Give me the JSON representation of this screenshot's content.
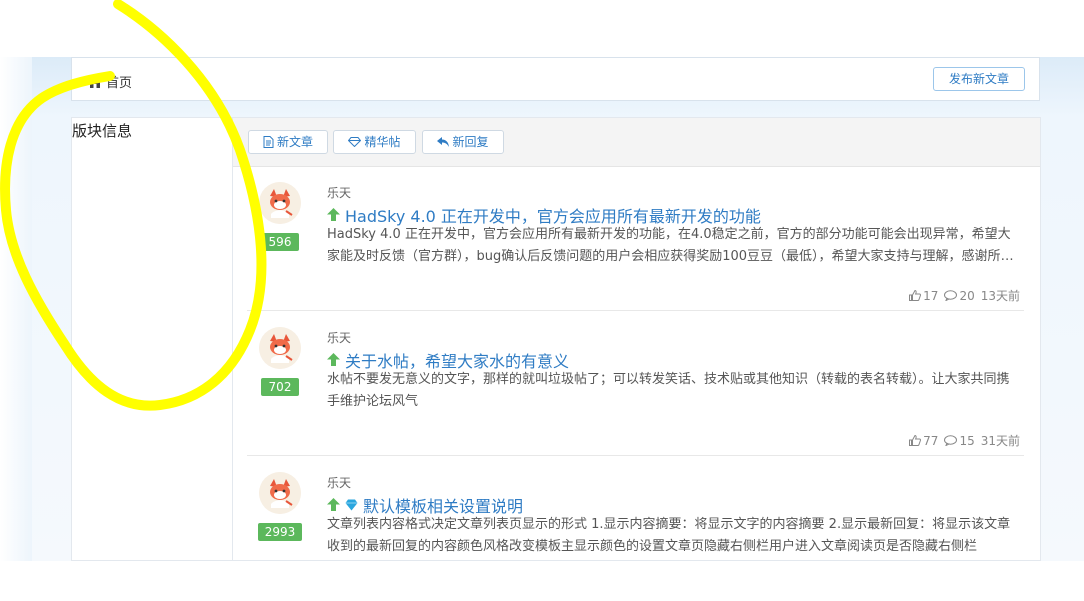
{
  "breadcrumb": {
    "home_label": "首页"
  },
  "header": {
    "publish_label": "发布新文章"
  },
  "sidebar": {
    "title": "版块信息"
  },
  "tabs": [
    {
      "label": "新文章",
      "icon": "document-icon"
    },
    {
      "label": "精华帖",
      "icon": "diamond-icon"
    },
    {
      "label": "新回复",
      "icon": "reply-icon"
    }
  ],
  "posts": [
    {
      "author": "乐天",
      "badge": "596",
      "title": "HadSky 4.0 正在开发中，官方会应用所有最新开发的功能",
      "summary": "HadSky 4.0 正在开发中，官方会应用所有最新开发的功能，在4.0稳定之前，官方的部分功能可能会出现异常，希望大家能及时反馈（官方群），bug确认后反馈问题的用户会相应获得奖励100豆豆（最低），希望大家支持与理解，感谢所有支持HadSky的朋友们",
      "likes": "17",
      "comments": "20",
      "time": "13天前",
      "icons": [
        "up-arrow-icon"
      ]
    },
    {
      "author": "乐天",
      "badge": "702",
      "title": "关于水帖，希望大家水的有意义",
      "summary": "水帖不要发无意义的文字，那样的就叫垃圾帖了；可以转发笑话、技术贴或其他知识（转载的表名转载）。让大家共同携手维护论坛风气",
      "likes": "77",
      "comments": "15",
      "time": "31天前",
      "icons": [
        "up-arrow-icon"
      ]
    },
    {
      "author": "乐天",
      "badge": "2993",
      "title": "默认模板相关设置说明",
      "summary": "文章列表内容格式决定文章列表页显示的形式 1.显示内容摘要：将显示文字的内容摘要 2.显示最新回复：将显示该文章收到的最新回复的内容颜色风格改变模板主显示颜色的设置文章页隐藏右侧栏用户进入文章阅读页是否隐藏右侧栏",
      "likes": "",
      "comments": "",
      "time": "",
      "icons": [
        "up-arrow-icon",
        "diamond-icon"
      ]
    }
  ],
  "colors": {
    "accent": "#2f7cc4",
    "badge": "#5cb85c",
    "highlight": "#ffff00",
    "up_arrow": "#5cb85c",
    "diamond": "#2aa6de"
  }
}
